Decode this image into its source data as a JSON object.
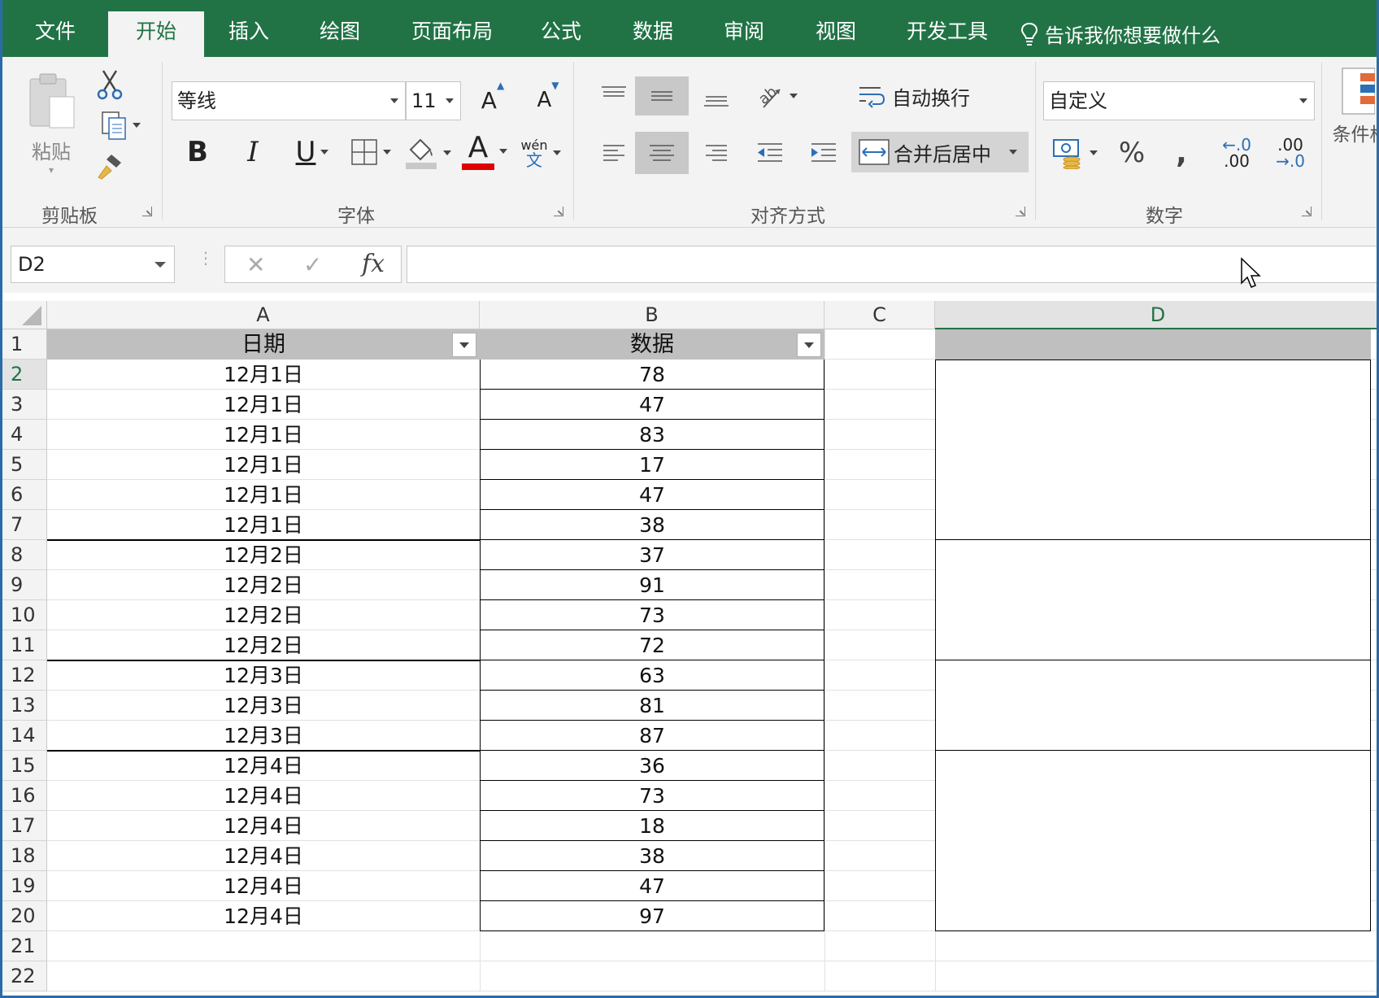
{
  "ribbon": {
    "tabs": [
      "文件",
      "开始",
      "插入",
      "绘图",
      "页面布局",
      "公式",
      "数据",
      "审阅",
      "视图",
      "开发工具"
    ],
    "active_tab": "开始",
    "tell_me": "告诉我你想要做什么",
    "clipboard": {
      "paste_label": "粘贴",
      "group_label": "剪贴板"
    },
    "font": {
      "name": "等线",
      "size": "11",
      "group_label": "字体",
      "phonetic": "wén",
      "phonetic_char": "文",
      "bold": "B",
      "italic": "I",
      "underline": "U",
      "grow": "A",
      "shrink": "A",
      "color_letter": "A"
    },
    "alignment": {
      "wrap_label": "自动换行",
      "merge_label": "合并后居中",
      "group_label": "对齐方式"
    },
    "number": {
      "format": "自定义",
      "group_label": "数字",
      "percent": "%",
      "comma": ",",
      "inc_top": "←.0",
      "inc_bottom": ".00",
      "dec_top": ".00",
      "dec_bottom": "→.0"
    },
    "styles": {
      "conditional_label": "条件格"
    },
    "colors": {
      "brand": "#217346",
      "font_color_bar": "#e00000",
      "header_fill": "#bfbfbf"
    }
  },
  "formula_bar": {
    "name_box": "D2",
    "cancel": "✕",
    "enter": "✓",
    "fx": "fx",
    "value": ""
  },
  "sheet": {
    "columns": [
      "A",
      "B",
      "C",
      "D"
    ],
    "row_numbers": [
      "1",
      "2",
      "3",
      "4",
      "5",
      "6",
      "7",
      "8",
      "9",
      "10",
      "11",
      "12",
      "13",
      "14",
      "15",
      "16",
      "17",
      "18",
      "19",
      "20",
      "21",
      "22"
    ],
    "headers": {
      "a": "日期",
      "b": "数据"
    },
    "rows": [
      {
        "date": "12月1日",
        "value": "78"
      },
      {
        "date": "12月1日",
        "value": "47"
      },
      {
        "date": "12月1日",
        "value": "83"
      },
      {
        "date": "12月1日",
        "value": "17"
      },
      {
        "date": "12月1日",
        "value": "47"
      },
      {
        "date": "12月1日",
        "value": "38"
      },
      {
        "date": "12月2日",
        "value": "37"
      },
      {
        "date": "12月2日",
        "value": "91"
      },
      {
        "date": "12月2日",
        "value": "73"
      },
      {
        "date": "12月2日",
        "value": "72"
      },
      {
        "date": "12月3日",
        "value": "63"
      },
      {
        "date": "12月3日",
        "value": "81"
      },
      {
        "date": "12月3日",
        "value": "87"
      },
      {
        "date": "12月4日",
        "value": "36"
      },
      {
        "date": "12月4日",
        "value": "73"
      },
      {
        "date": "12月4日",
        "value": "18"
      },
      {
        "date": "12月4日",
        "value": "38"
      },
      {
        "date": "12月4日",
        "value": "47"
      },
      {
        "date": "12月4日",
        "value": "97"
      }
    ]
  }
}
